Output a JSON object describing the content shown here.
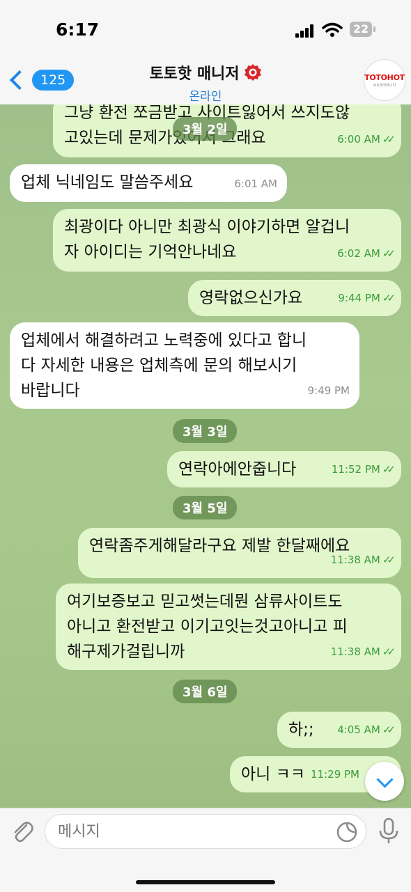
{
  "status_bar": {
    "time": "6:17",
    "battery": "22"
  },
  "header": {
    "back_count": "125",
    "title": "토토핫 매니저",
    "subtitle": "온라인",
    "avatar_brand": "TOTOHOT",
    "avatar_sub": "토토핫커뮤니티"
  },
  "messages": [
    {
      "text": "그냥 환전 쪼금받고 사이트잃어서 쓰지도않\n고있는데 문제가있어서 그래요",
      "time": "6:00 AM"
    },
    {
      "text": "업체 닉네임도 말씀주세요",
      "time": "6:01 AM"
    },
    {
      "text": "최광이다 아니만 최광식 이야기하면 알겁니\n자 아이디는 기억안나네요",
      "time": "6:02 AM"
    },
    {
      "text": "영락없으신가요",
      "time": "9:44 PM"
    },
    {
      "text": "업체에서 해결하려고 노력중에 있다고 합니\n다 자세한 내용은 업체측에 문의 해보시기\n바랍니다",
      "time": "9:49 PM"
    },
    {
      "text": "연락아에안줍니다",
      "time": "11:52 PM"
    },
    {
      "text": "연락좀주게해달라구요 제발 한달째에요",
      "time": "11:38 AM"
    },
    {
      "text": "여기보증보고 믿고썻는데뭔 삼류사이트도\n아니고 환전받고 이기고잇는것고아니고 피\n해구제가걸립니까",
      "time": "11:38 AM"
    },
    {
      "text": "하;;",
      "time": "4:05 AM"
    },
    {
      "text": "아니 ㅋㅋ",
      "time": "11:29 PM"
    }
  ],
  "dates": [
    "3월 2일",
    "3월 3일",
    "3월 5일",
    "3월 6일"
  ],
  "input": {
    "placeholder": "메시지"
  },
  "colors": {
    "accent": "#2196f3",
    "out_bubble": "#e1f7cb",
    "in_bubble": "#ffffff",
    "check": "#3c9a3c"
  }
}
